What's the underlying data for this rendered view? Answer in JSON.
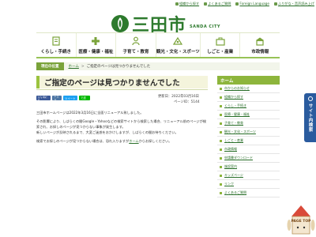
{
  "utility": {
    "items": [
      {
        "label": "組織から探す"
      },
      {
        "label": "よくあるご質問"
      },
      {
        "label": "Foreign Language"
      },
      {
        "label": "ふりがな・音声読み上げ"
      }
    ]
  },
  "logo": {
    "ja": "三田市",
    "en": "SANDA CITY"
  },
  "nav": [
    {
      "label": "くらし・手続き",
      "icon": "document-icon"
    },
    {
      "label": "医療・健康・福祉",
      "icon": "medical-icon"
    },
    {
      "label": "子育て・教育",
      "icon": "child-icon"
    },
    {
      "label": "観光・文化・スポーツ",
      "icon": "tourism-icon"
    },
    {
      "label": "しごと・産業",
      "icon": "work-icon"
    },
    {
      "label": "市政情報",
      "icon": "city-hall-icon"
    }
  ],
  "breadcrumb": {
    "here": "現在の位置",
    "home": "ホーム",
    "sep": ">",
    "current": "ご指定のページは見つかりませんでした"
  },
  "page": {
    "title": "ご指定のページは見つかりませんでした",
    "updated": "更新日：2022年03月16日",
    "page_id": "ページID：5144"
  },
  "sns": [
    "いいね！0",
    "シェア",
    "ツイート",
    "LINEで送る"
  ],
  "content": {
    "p1": "三田市ホームページは2022年3月16日に全面リニューアル致しました。",
    "p2": "その影響により、しばらくの間Google・Yahooなどの検索サイトから検索した場合、リニューアル前のページが検索され、お探しのページが見つからない事象が発生します。",
    "p3": "新しいページが反映されるまで、大変ご迷惑をおかけしますが、しばらくの間お待ちください。",
    "p4a": "検索でお探しのページが見つからない場合は、恐れ入りますが",
    "p4link": "ホーム",
    "p4b": "からお探しください。"
  },
  "side": {
    "head": "ホーム",
    "items": [
      {
        "label": "市からのお知らせ"
      },
      {
        "label": "組織から探す"
      },
      {
        "label": "くらし・手続き"
      },
      {
        "label": "医療・健康・福祉"
      },
      {
        "label": "子育て・教育"
      },
      {
        "label": "観光・文化・スポーツ"
      },
      {
        "label": "しごと・産業"
      },
      {
        "label": "市政情報"
      },
      {
        "label": "申請書ダウンロード"
      },
      {
        "label": "施設案内"
      },
      {
        "label": "キッズページ"
      },
      {
        "label": "リンク"
      },
      {
        "label": "よくあるご質問"
      }
    ]
  },
  "tab": {
    "label": "サイト内検索"
  },
  "page_top": {
    "label": "PAGE TOP"
  },
  "colors": {
    "green": "#2d7a2d",
    "accent": "#8db53c",
    "tab": "#2a5b9e"
  }
}
